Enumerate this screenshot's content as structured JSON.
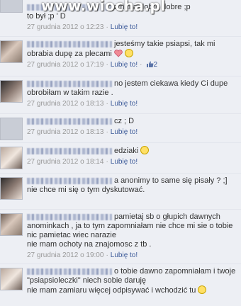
{
  "watermark": "www.wiocha.pl",
  "like_label": "Lubię to!",
  "separator": "·",
  "comments": [
    {
      "text": "z haha dobre dobre ;p\nto był ;p ' D",
      "time": "27 grudnia 2012 o 12:23",
      "likes": "",
      "emoji": ""
    },
    {
      "text": "jesteśmy takie psiapsi, tak mi obrabia dupę za plecami",
      "time": "27 grudnia 2012 o 17:19",
      "likes": "2",
      "emoji": "heart-icon"
    },
    {
      "text": "no jestem ciekawa kiedy Ci dupe obrobiłam w takim razie .",
      "time": "27 grudnia 2012 o 18:13",
      "likes": "",
      "emoji": ""
    },
    {
      "text": "cz ; D",
      "time": "27 grudnia 2012 o 18:13",
      "likes": "",
      "emoji": ""
    },
    {
      "text": "edziaki",
      "time": "27 grudnia 2012 o 18:14",
      "likes": "",
      "emoji": "smiley-icon"
    },
    {
      "text": "a anonimy to same się pisały ? ;] nie chce mi się o tym dyskutować.",
      "time": "27 grudnia 2012 o 18:14",
      "likes": "",
      "emoji": ""
    },
    {
      "text": "pamietaj sb o głupich dawnych anominkach , ja to tym zapomniałam nie chce mi sie o tobie nic pamietac wiec narazie\nnie mam ochoty na znajomosc z tb .",
      "time": "27 grudnia 2012 o 19:00",
      "likes": "",
      "emoji": ""
    },
    {
      "text": "o tobie dawno zapomniałam i twoje \"psiapsioleczki\" niech sobie daruję\nnie mam zamiaru więcej odpisywać i wchodzić tu",
      "time": "",
      "likes": "",
      "emoji": "smiley-icon"
    }
  ]
}
